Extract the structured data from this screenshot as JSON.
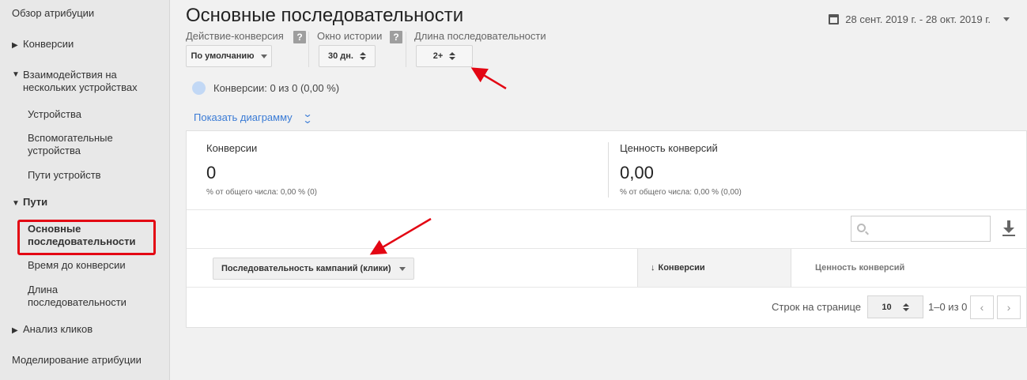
{
  "sidebar": {
    "overview": "Обзор атрибуции",
    "conversions": "Конверсии",
    "cross_device": "Взаимодействия на нескольких устройствах",
    "devices": "Устройства",
    "assisting_devices": "Вспомогательные устройства",
    "device_paths": "Пути устройств",
    "paths": "Пути",
    "top_paths": "Основные последовательности",
    "time_lag": "Время до конверсии",
    "path_length": "Длина последовательности",
    "click_analysis": "Анализ кликов",
    "modeling": "Моделирование атрибуции",
    "expand_arrow": "▶",
    "collapse_arrow": "▼"
  },
  "header": {
    "title": "Основные последовательности",
    "date_range": "28 сент. 2019 г. - 28 окт. 2019 г."
  },
  "filters": {
    "conversion_action_label": "Действие-конверсия",
    "conversion_action_value": "По умолчанию",
    "lookback_label": "Окно истории",
    "lookback_value": "30 дн.",
    "path_length_label": "Длина последовательности",
    "path_length_value": "2+",
    "help_glyph": "?"
  },
  "legend": {
    "text": "Конверсии: 0 из 0 (0,00 %)",
    "color": "#c2d8f5"
  },
  "show_chart": "Показать диаграмму",
  "metrics": {
    "conversions_title": "Конверсии",
    "conversions_value": "0",
    "conversions_sub": "% от общего числа: 0,00 % (0)",
    "value_title": "Ценность конверсий",
    "value_value": "0,00",
    "value_sub": "% от общего числа: 0,00 % (0,00)"
  },
  "table": {
    "dimension": "Последовательность кампаний (клики)",
    "sort_arrow": "↓",
    "col_conversions": "Конверсии",
    "col_value": "Ценность конверсий"
  },
  "pagination": {
    "rows_label": "Строк на странице",
    "rows_value": "10",
    "range": "1–0 из 0",
    "prev": "‹",
    "next": "›"
  },
  "colors": {
    "accent": "#3a7bd5",
    "annotation": "#e30613"
  }
}
